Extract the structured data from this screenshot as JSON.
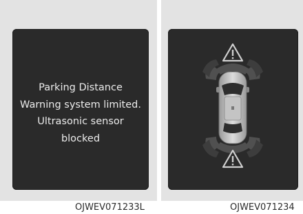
{
  "left_panel": {
    "message_lines": [
      "Parking Distance",
      "Warning system limited.",
      "Ultrasonic sensor",
      "blocked"
    ],
    "code": "OJWEV071233L"
  },
  "right_panel": {
    "code": "OJWEV071234",
    "icons": [
      "warning-triangle",
      "car-top-view",
      "sensor-zones"
    ]
  }
}
